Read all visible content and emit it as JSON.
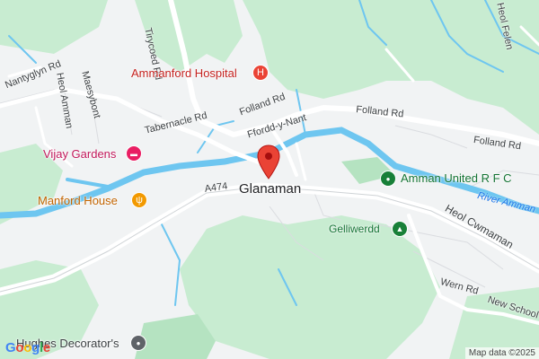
{
  "map": {
    "town": "Glanaman",
    "roads": {
      "tirycoed": "Tirycoed Rd",
      "nantyglyn": "Nantyglyn Rd",
      "heol_amman": "Heol Amman",
      "maesybont": "Maesybont",
      "tabernacle": "Tabernacle Rd",
      "folland_1": "Folland Rd",
      "folland_2": "Folland Rd",
      "folland_3": "Folland Rd",
      "ffordd": "Ffordd-y-Nant",
      "a474": "A474",
      "heol_cwmaman": "Heol Cwmaman",
      "wern": "Wern Rd",
      "new_school": "New School",
      "heol_felen": "Heol Felen",
      "amman_rfc_rd": "Amman United R F C"
    },
    "water": {
      "river": "River Amman"
    },
    "pois": {
      "hospital": "Ammanford Hospital",
      "vijay": "Vijay Gardens",
      "manford": "Manford House",
      "amman_united": "Amman United R F C",
      "gelliwerdd": "Gelliwerdd",
      "hughes": "Hughes Decorator's"
    },
    "icons": {
      "hospital": "H",
      "hotel": "▬",
      "restaurant": "ψ",
      "park": "▲",
      "place": "●"
    },
    "colors": {
      "hospital": "#ea4335",
      "hotel": "#e91e63",
      "restaurant": "#f29900",
      "green": "#188038",
      "grey": "#5f6368",
      "water": "#4fc3f7",
      "forest": "#c8ecd1",
      "pin": "#ea4335"
    },
    "attribution": "Map data ©2025",
    "logo": "Google"
  }
}
